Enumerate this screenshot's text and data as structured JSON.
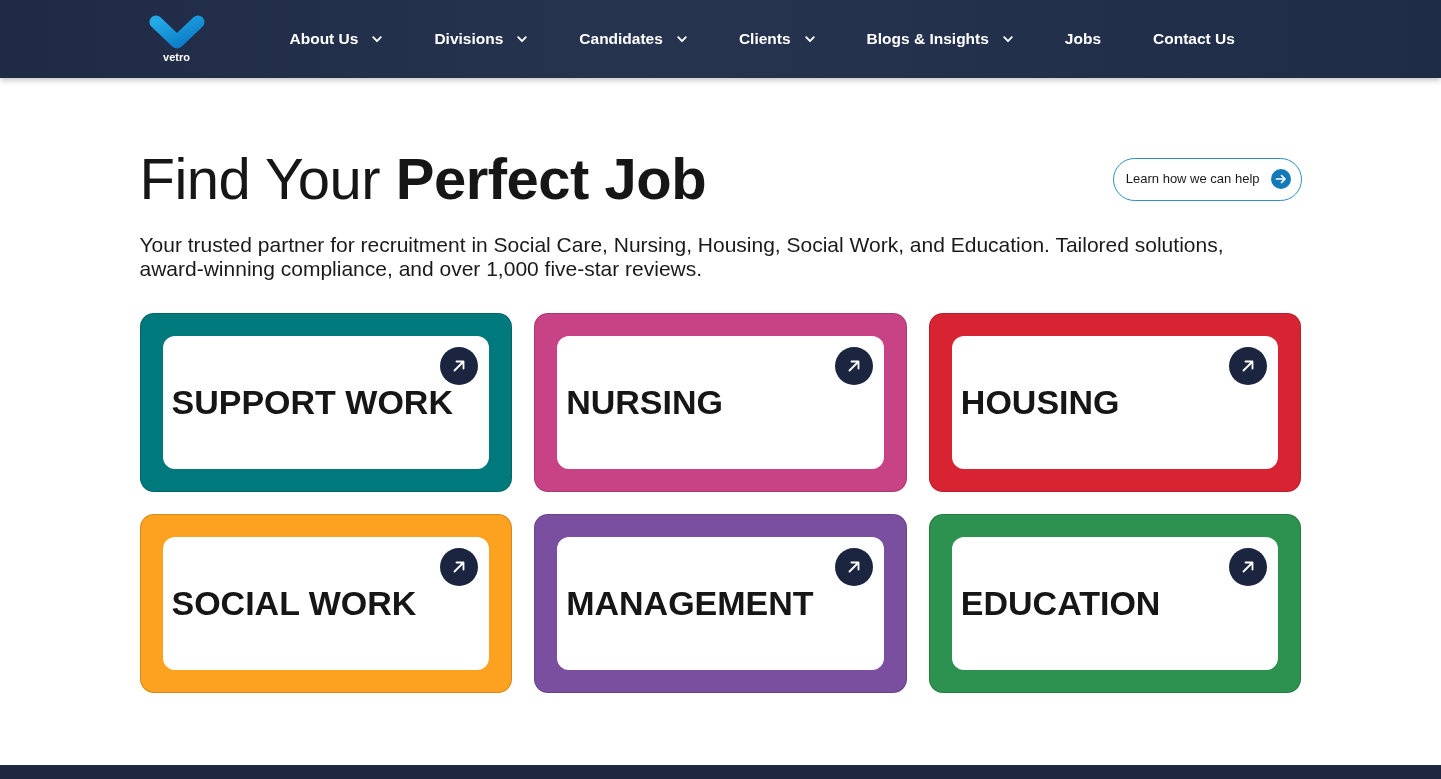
{
  "navbar": {
    "logo_text": "vetro",
    "items": [
      {
        "label": "About Us",
        "has_menu": true
      },
      {
        "label": "Divisions",
        "has_menu": true
      },
      {
        "label": "Candidates",
        "has_menu": true
      },
      {
        "label": "Clients",
        "has_menu": true
      },
      {
        "label": "Blogs & Insights",
        "has_menu": true
      },
      {
        "label": "Jobs",
        "has_menu": false
      },
      {
        "label": "Contact Us",
        "has_menu": false
      }
    ]
  },
  "hero": {
    "title": "Find Your **Perfect Job**",
    "button": "Learn how we can help",
    "intro": "Your trusted partner for recruitment in Social Care, Nursing, Housing, Social Work, and Education. Tailored solutions, award-winning compliance, and over 1,000 five-star reviews."
  },
  "categories": [
    {
      "label": "SUPPORT WORK",
      "color": "#00797c"
    },
    {
      "label": "NURSING",
      "color": "#c84385"
    },
    {
      "label": "HOUSING",
      "color": "#d82332"
    },
    {
      "label": "SOCIAL WORK",
      "color": "#fca120"
    },
    {
      "label": "MANAGEMENT",
      "color": "#7b4fa0"
    },
    {
      "label": "EDUCATION",
      "color": "#2d914f"
    }
  ]
}
